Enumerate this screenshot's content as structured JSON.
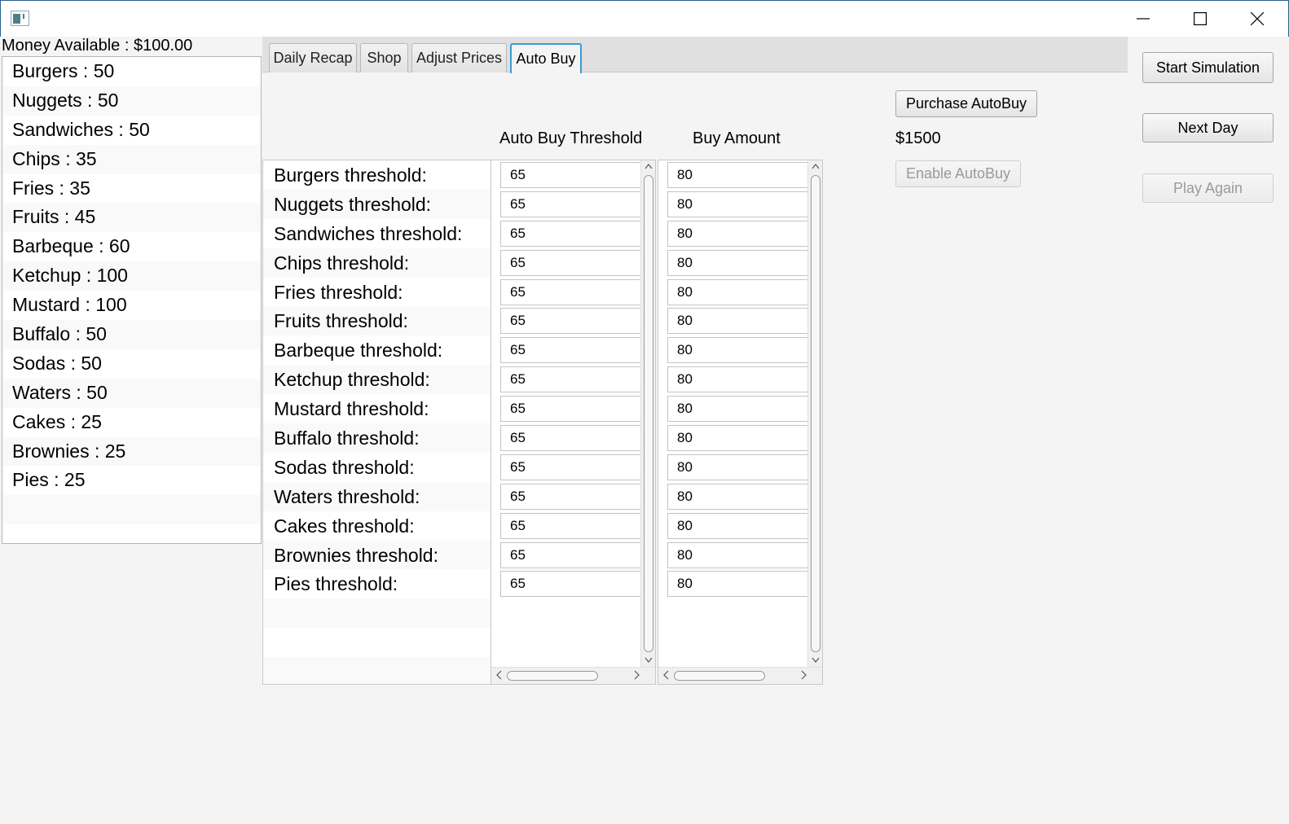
{
  "window": {
    "controls": {
      "minimize": "minimize-icon",
      "maximize": "maximize-icon",
      "close": "close-icon"
    }
  },
  "money_available": "Money Available : $100.00",
  "inventory": [
    "Burgers : 50",
    "Nuggets : 50",
    "Sandwiches : 50",
    "Chips : 35",
    "Fries : 35",
    "Fruits : 45",
    "Barbeque : 60",
    "Ketchup : 100",
    "Mustard : 100",
    "Buffalo : 50",
    "Sodas : 50",
    "Waters : 50",
    "Cakes : 25",
    "Brownies : 25",
    "Pies : 25",
    "",
    ""
  ],
  "tabs": [
    "Daily Recap",
    "Shop",
    "Adjust Prices",
    "Auto Buy"
  ],
  "active_tab": "Auto Buy",
  "auto_buy": {
    "threshold_header": "Auto Buy Threshold",
    "amount_header": "Buy Amount",
    "labels": [
      "Burgers threshold:",
      "Nuggets threshold:",
      "Sandwiches threshold:",
      "Chips threshold:",
      "Fries threshold:",
      "Fruits threshold:",
      "Barbeque threshold:",
      "Ketchup threshold:",
      "Mustard threshold:",
      "Buffalo threshold:",
      "Sodas threshold:",
      "Waters threshold:",
      "Cakes threshold:",
      "Brownies threshold:",
      "Pies threshold:",
      "",
      "",
      ""
    ],
    "thresholds": [
      "65",
      "65",
      "65",
      "65",
      "65",
      "65",
      "65",
      "65",
      "65",
      "65",
      "65",
      "65",
      "65",
      "65",
      "65"
    ],
    "amounts": [
      "80",
      "80",
      "80",
      "80",
      "80",
      "80",
      "80",
      "80",
      "80",
      "80",
      "80",
      "80",
      "80",
      "80",
      "80"
    ],
    "purchase_button": "Purchase AutoBuy",
    "cost": "$1500",
    "enable_button": "Enable AutoBuy"
  },
  "controls": {
    "start_simulation": "Start Simulation",
    "next_day": "Next Day",
    "play_again": "Play Again"
  }
}
